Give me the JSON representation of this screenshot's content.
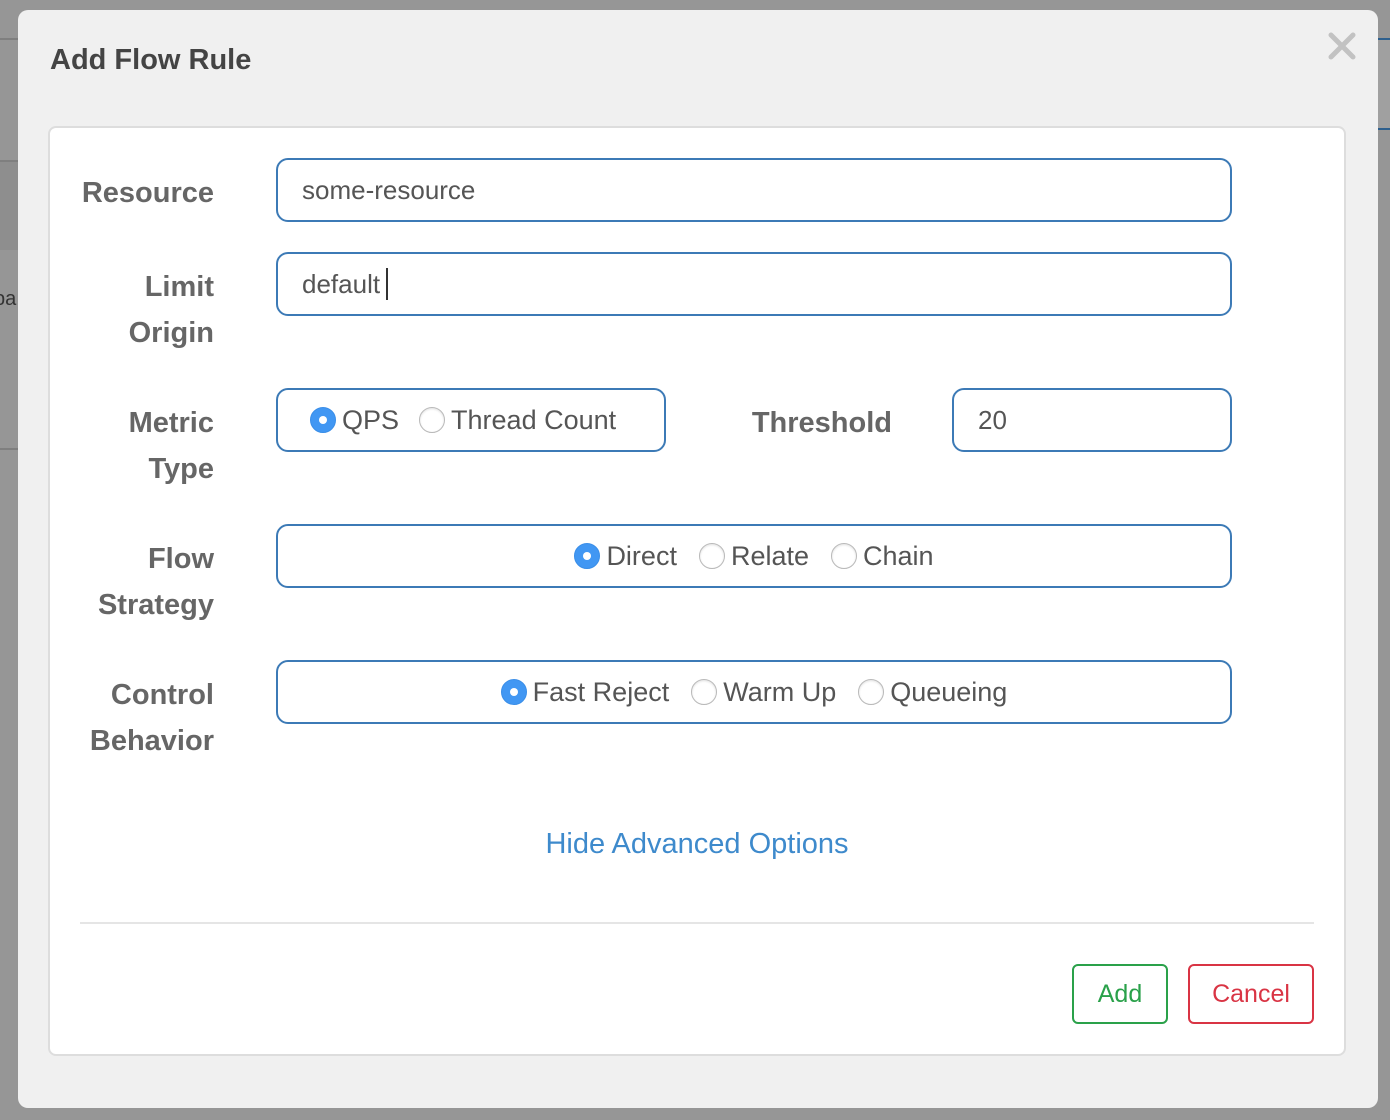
{
  "backdrop": {
    "partial_text": "pa"
  },
  "modal": {
    "title": "Add Flow Rule",
    "close_icon": "close-icon"
  },
  "form": {
    "resource": {
      "label": "Resource",
      "value": "some-resource"
    },
    "limit_origin": {
      "label_line1": "Limit",
      "label_line2": "Origin",
      "value": "default"
    },
    "metric_type": {
      "label_line1": "Metric",
      "label_line2": "Type",
      "options": [
        {
          "label": "QPS",
          "checked": true
        },
        {
          "label": "Thread Count",
          "checked": false
        }
      ]
    },
    "threshold": {
      "label": "Threshold",
      "value": "20"
    },
    "flow_strategy": {
      "label_line1": "Flow",
      "label_line2": "Strategy",
      "options": [
        {
          "label": "Direct",
          "checked": true
        },
        {
          "label": "Relate",
          "checked": false
        },
        {
          "label": "Chain",
          "checked": false
        }
      ]
    },
    "control_behavior": {
      "label_line1": "Control",
      "label_line2": "Behavior",
      "options": [
        {
          "label": "Fast Reject",
          "checked": true
        },
        {
          "label": "Warm Up",
          "checked": false
        },
        {
          "label": "Queueing",
          "checked": false
        }
      ]
    },
    "advanced_toggle": "Hide Advanced Options"
  },
  "footer": {
    "add_label": "Add",
    "cancel_label": "Cancel"
  },
  "colors": {
    "accent_border": "#3c7ab6",
    "radio_checked": "#4197f3",
    "link": "#3e8acc",
    "add": "#2aa14a",
    "cancel": "#d93444"
  }
}
